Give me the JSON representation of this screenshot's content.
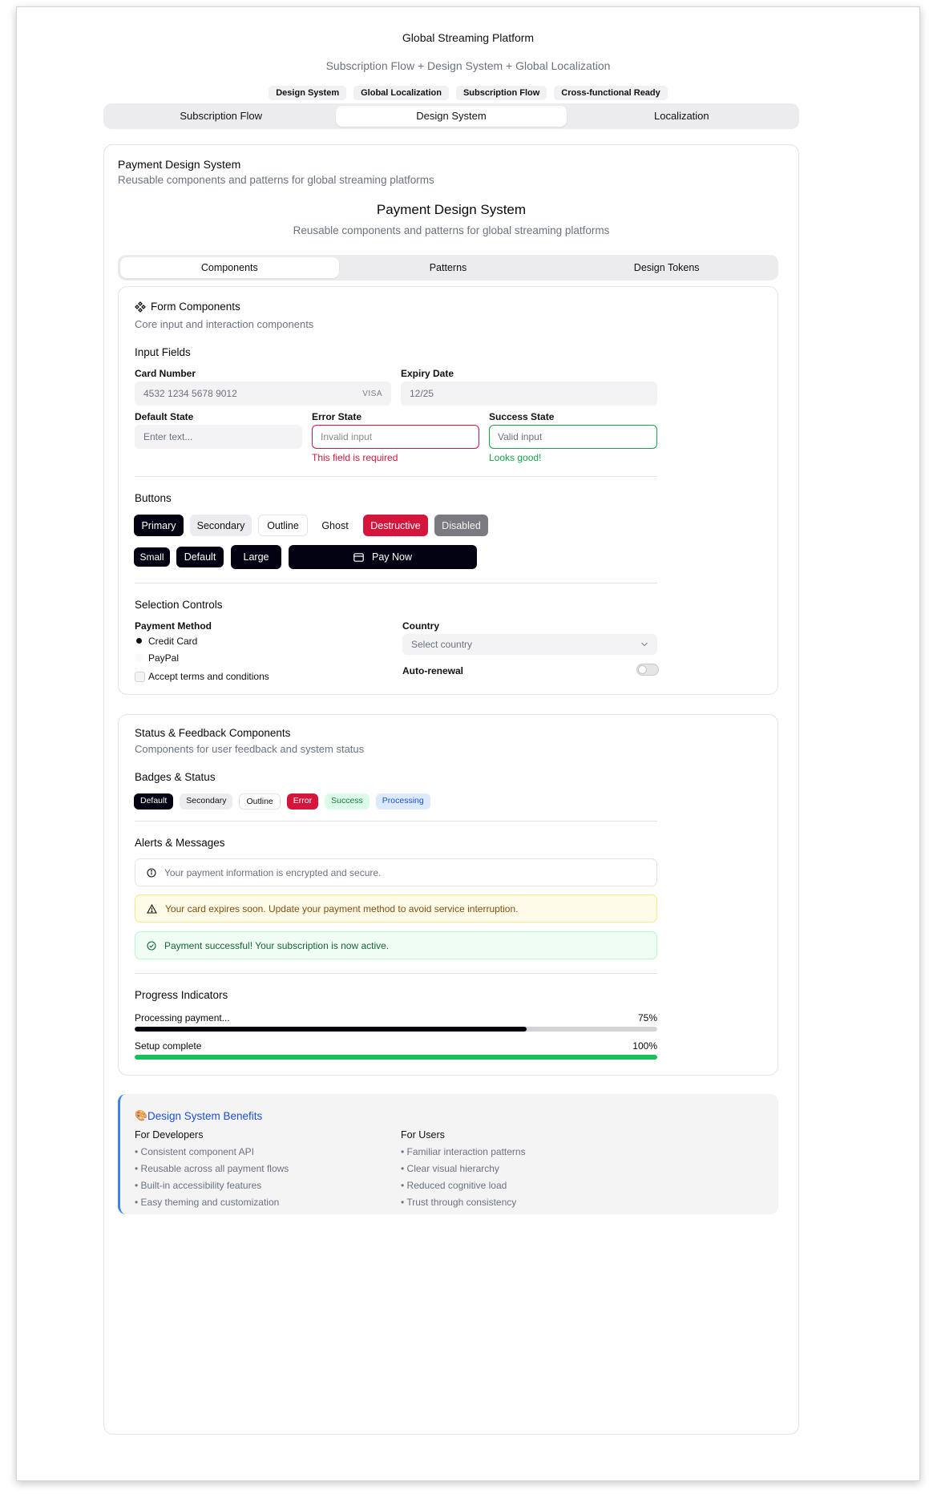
{
  "header": {
    "title": "Global Streaming Platform",
    "subtitle": "Subscription Flow + Design System + Global Localization",
    "chips": [
      "Design System",
      "Global Localization",
      "Subscription Flow",
      "Cross-functional Ready"
    ]
  },
  "main_tabs": [
    "Subscription Flow",
    "Design System",
    "Localization"
  ],
  "active_main_tab": "Design System",
  "card": {
    "title": "Payment Design System",
    "description": "Reusable components and patterns for global streaming platforms",
    "center_title": "Payment Design System",
    "center_subtitle": "Reusable components and patterns for global streaming platforms"
  },
  "sub_tabs": [
    "Components",
    "Patterns",
    "Design Tokens"
  ],
  "active_sub_tab": "Components",
  "form": {
    "title": "Form Components",
    "description": "Core input and interaction components",
    "input_fields_heading": "Input Fields",
    "card_number_label": "Card Number",
    "card_number_value": "4532 1234 5678 9012",
    "card_brand": "VISA",
    "expiry_label": "Expiry Date",
    "expiry_value": "12/25",
    "default_label": "Default State",
    "default_placeholder": "Enter text...",
    "error_label": "Error State",
    "error_value": "Invalid input",
    "error_message": "This field is required",
    "success_label": "Success State",
    "success_value": "Valid input",
    "success_message": "Looks good!",
    "buttons_heading": "Buttons",
    "buttons": {
      "primary": "Primary",
      "secondary": "Secondary",
      "outline": "Outline",
      "ghost": "Ghost",
      "destructive": "Destructive",
      "disabled": "Disabled",
      "small": "Small",
      "default": "Default",
      "large": "Large",
      "pay_now": "Pay Now"
    },
    "selection_heading": "Selection Controls",
    "payment_method_label": "Payment Method",
    "radio_options": [
      "Credit Card",
      "PayPal"
    ],
    "selected_radio": "Credit Card",
    "terms_label": "Accept terms and conditions",
    "country_label": "Country",
    "country_placeholder": "Select country",
    "auto_renewal_label": "Auto-renewal"
  },
  "status": {
    "title": "Status & Feedback Components",
    "description": "Components for user feedback and system status",
    "badges_heading": "Badges & Status",
    "badges": [
      "Default",
      "Secondary",
      "Outline",
      "Error",
      "Success",
      "Processing"
    ],
    "alerts_heading": "Alerts & Messages",
    "alerts": {
      "info": "Your payment information is encrypted and secure.",
      "warning": "Your card expires soon. Update your payment method to avoid service interruption.",
      "success": "Payment successful! Your subscription is now active."
    },
    "progress_heading": "Progress Indicators",
    "progress": [
      {
        "label": "Processing payment...",
        "value_text": "75%",
        "value": 0.75,
        "color": "#030213"
      },
      {
        "label": "Setup complete",
        "value_text": "100%",
        "value": 1.0,
        "color": "#16c05a"
      }
    ]
  },
  "benefits": {
    "title": "Design System Benefits",
    "developers_heading": "For Developers",
    "developers": [
      "• Consistent component API",
      "• Reusable across all payment flows",
      "• Built-in accessibility features",
      "• Easy theming and customization"
    ],
    "users_heading": "For Users",
    "users": [
      "• Familiar interaction patterns",
      "• Clear visual hierarchy",
      "• Reduced cognitive load",
      "• Trust through consistency"
    ]
  },
  "colors": {
    "primary": "#030213",
    "destructive": "#d4163c",
    "success": "#16a34a",
    "info_accent": "#3b82f6"
  }
}
